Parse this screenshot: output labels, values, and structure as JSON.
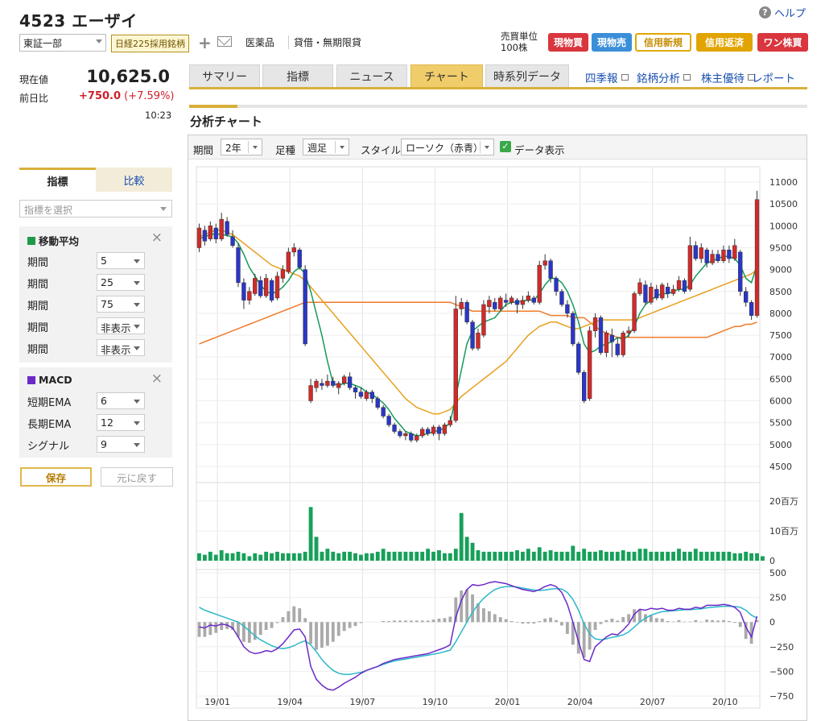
{
  "header": {
    "title": "4523 エーザイ",
    "help": "ヘルプ",
    "market": "東証一部",
    "nikkei_badge": "日経225採用銘柄",
    "sector": "医薬品",
    "lending": "貸借・無期限貸",
    "unit_label": "売買単位",
    "unit_value": "100株",
    "buttons": {
      "spot_buy": "現物買",
      "spot_sell": "現物売",
      "margin_new": "信用新規",
      "margin_close": "信用返済",
      "one_share": "ワン株買"
    }
  },
  "quote": {
    "price_label": "現在値",
    "price": "10,625.0",
    "change_label": "前日比",
    "change": "+750.0",
    "change_pct": "(+7.59%)",
    "time": "10:23"
  },
  "tabs": [
    "サマリー",
    "指標",
    "ニュース",
    "チャート",
    "時系列データ"
  ],
  "active_tab": "チャート",
  "links": [
    "四季報",
    "銘柄分析",
    "株主優待",
    "レポート"
  ],
  "section_title": "分析チャート",
  "toolbar": {
    "period_label": "期間",
    "period_value": "2年",
    "bar_label": "足種",
    "bar_value": "週足",
    "style_label": "スタイル",
    "style_value": "ローソク（赤青）",
    "data_display": "データ表示",
    "check": "✓"
  },
  "sidebar": {
    "tab_indicator": "指標",
    "tab_compare": "比較",
    "select_placeholder": "指標を選択",
    "ma_title": "移動平均",
    "ma_rows": [
      {
        "label": "期間",
        "value": "5"
      },
      {
        "label": "期間",
        "value": "25"
      },
      {
        "label": "期間",
        "value": "75"
      },
      {
        "label": "期間",
        "value": "非表示"
      },
      {
        "label": "期間",
        "value": "非表示"
      }
    ],
    "macd_title": "MACD",
    "macd_rows": [
      {
        "label": "短期EMA",
        "value": "6"
      },
      {
        "label": "長期EMA",
        "value": "12"
      },
      {
        "label": "シグナル",
        "value": "9"
      }
    ],
    "save": "保存",
    "reset": "元に戻す",
    "close": "×"
  },
  "colors": {
    "up": "#d22a2a",
    "down": "#2a36c8",
    "ma5": "#159a5a",
    "ma25": "#e8a020",
    "ma75": "#f07a2a",
    "volume": "#17a05a",
    "macd": "#6a2ac8",
    "signal": "#2bb8c8",
    "hist": "#aaaaaa",
    "ma_square": "#1e9a4a",
    "macd_square": "#6a2ac8"
  },
  "chart_data": {
    "type": "candlestick",
    "price_axis": {
      "ticks": [
        "11000",
        "10500",
        "10000",
        "9500",
        "9000",
        "8500",
        "8000",
        "7500",
        "7000",
        "6500",
        "6000",
        "5500",
        "5000",
        "4500"
      ],
      "ylim": [
        4500,
        11000
      ]
    },
    "volume_axis": {
      "ticks": [
        "20百万",
        "10百万",
        "0"
      ]
    },
    "macd_axis": {
      "ticks": [
        "500",
        "250",
        "0",
        "−250",
        "−500",
        "−750"
      ],
      "ylim": [
        -750,
        500
      ]
    },
    "x_ticks": [
      "19/01",
      "19/04",
      "19/07",
      "19/10",
      "20/01",
      "20/04",
      "20/07",
      "20/10"
    ],
    "candles": [
      [
        9500,
        9950,
        9400,
        10050
      ],
      [
        9900,
        9650,
        9550,
        10000
      ],
      [
        9700,
        10000,
        9650,
        10100
      ],
      [
        9950,
        9700,
        9600,
        10050
      ],
      [
        9700,
        10150,
        9650,
        10300
      ],
      [
        10100,
        9800,
        9750,
        10200
      ],
      [
        9750,
        9550,
        9500,
        9900
      ],
      [
        9500,
        8700,
        8600,
        9600
      ],
      [
        8700,
        8300,
        8100,
        8800
      ],
      [
        8300,
        8500,
        8200,
        8600
      ],
      [
        8450,
        8800,
        8400,
        8900
      ],
      [
        8750,
        8400,
        8350,
        8850
      ],
      [
        8400,
        8800,
        8350,
        8900
      ],
      [
        8750,
        8300,
        8250,
        8800
      ],
      [
        8350,
        8850,
        8300,
        8950
      ],
      [
        8800,
        9000,
        8700,
        9100
      ],
      [
        8950,
        9400,
        8900,
        9500
      ],
      [
        9400,
        9500,
        9300,
        9600
      ],
      [
        9450,
        9050,
        9000,
        9500
      ],
      [
        9000,
        7300,
        7250,
        9100
      ],
      [
        6000,
        6350,
        5950,
        6500
      ],
      [
        6300,
        6450,
        6200,
        6500
      ],
      [
        6400,
        6350,
        6250,
        6500
      ],
      [
        6350,
        6450,
        6300,
        6600
      ],
      [
        6450,
        6350,
        6300,
        6550
      ],
      [
        6300,
        6400,
        6150,
        6450
      ],
      [
        6400,
        6550,
        6350,
        6600
      ],
      [
        6550,
        6300,
        6250,
        6650
      ],
      [
        6300,
        6200,
        6050,
        6350
      ],
      [
        6200,
        6100,
        6050,
        6300
      ],
      [
        6050,
        6200,
        6000,
        6250
      ],
      [
        6200,
        6050,
        5950,
        6250
      ],
      [
        6050,
        5850,
        5800,
        6100
      ],
      [
        5850,
        5650,
        5600,
        5900
      ],
      [
        5650,
        5450,
        5400,
        5700
      ],
      [
        5450,
        5300,
        5250,
        5500
      ],
      [
        5300,
        5200,
        5150,
        5350
      ],
      [
        5200,
        5250,
        5100,
        5300
      ],
      [
        5250,
        5100,
        5050,
        5300
      ],
      [
        5100,
        5200,
        5050,
        5250
      ],
      [
        5200,
        5350,
        5150,
        5400
      ],
      [
        5350,
        5250,
        5200,
        5400
      ],
      [
        5250,
        5400,
        5200,
        5450
      ],
      [
        5400,
        5250,
        5100,
        5450
      ],
      [
        5250,
        5450,
        5200,
        5500
      ],
      [
        5450,
        5550,
        5400,
        5650
      ],
      [
        5550,
        8100,
        5500,
        8400
      ],
      [
        8100,
        8250,
        7950,
        8350
      ],
      [
        8250,
        7800,
        7750,
        8300
      ],
      [
        7800,
        7200,
        7150,
        7850
      ],
      [
        7200,
        7550,
        7150,
        7650
      ],
      [
        7500,
        8200,
        7450,
        8300
      ],
      [
        8150,
        8300,
        8000,
        8400
      ],
      [
        8250,
        8100,
        8050,
        8350
      ],
      [
        8100,
        8350,
        8050,
        8400
      ],
      [
        8300,
        8250,
        8150,
        8450
      ],
      [
        8250,
        8350,
        8200,
        8400
      ],
      [
        8300,
        8200,
        8000,
        8350
      ],
      [
        8200,
        8300,
        8100,
        8400
      ],
      [
        8300,
        8400,
        8250,
        8500
      ],
      [
        8350,
        8250,
        8200,
        8400
      ],
      [
        8250,
        9100,
        8200,
        9200
      ],
      [
        9100,
        9200,
        9000,
        9350
      ],
      [
        9200,
        8800,
        8700,
        9250
      ],
      [
        8800,
        8500,
        8400,
        8850
      ],
      [
        8500,
        8200,
        8150,
        8550
      ],
      [
        8200,
        8000,
        7900,
        8300
      ],
      [
        8000,
        7300,
        7250,
        8050
      ],
      [
        7300,
        6650,
        6600,
        7350
      ],
      [
        6650,
        6000,
        5950,
        6700
      ],
      [
        6050,
        7600,
        6000,
        7700
      ],
      [
        7600,
        7900,
        7450,
        8000
      ],
      [
        7900,
        7100,
        7050,
        7950
      ],
      [
        7100,
        7550,
        7000,
        7600
      ],
      [
        7500,
        7350,
        7000,
        7650
      ],
      [
        7300,
        7050,
        7000,
        7450
      ],
      [
        7050,
        7550,
        7000,
        7600
      ],
      [
        7550,
        7600,
        7450,
        7700
      ],
      [
        7600,
        8450,
        7550,
        8500
      ],
      [
        8450,
        8700,
        8400,
        8800
      ],
      [
        8650,
        8250,
        8200,
        8750
      ],
      [
        8250,
        8600,
        8200,
        8700
      ],
      [
        8550,
        8350,
        8300,
        8650
      ],
      [
        8350,
        8650,
        8300,
        8700
      ],
      [
        8600,
        8450,
        8350,
        8700
      ],
      [
        8450,
        8550,
        8400,
        8650
      ],
      [
        8550,
        8750,
        8500,
        8850
      ],
      [
        8750,
        8500,
        8450,
        8800
      ],
      [
        8550,
        9550,
        8500,
        9750
      ],
      [
        9550,
        9250,
        9200,
        9650
      ],
      [
        9250,
        9500,
        9150,
        9600
      ],
      [
        9450,
        9150,
        9050,
        9500
      ],
      [
        9150,
        9350,
        9100,
        9450
      ],
      [
        9350,
        9200,
        9150,
        9450
      ],
      [
        9200,
        9450,
        9150,
        9550
      ],
      [
        9450,
        9250,
        9150,
        9550
      ],
      [
        9250,
        9550,
        9200,
        9700
      ],
      [
        9400,
        8500,
        8400,
        9450
      ],
      [
        8500,
        8250,
        8150,
        8600
      ],
      [
        8250,
        7950,
        7850,
        8300
      ],
      [
        7950,
        10600,
        7900,
        10800
      ]
    ],
    "ma5": [
      9700,
      9750,
      9800,
      9820,
      9800,
      9780,
      9750,
      9600,
      9350,
      9050,
      8850,
      8650,
      8500,
      8450,
      8500,
      8600,
      8750,
      8950,
      9050,
      8900,
      8500,
      8000,
      7500,
      6900,
      6400,
      6350,
      6400,
      6400,
      6350,
      6300,
      6200,
      6150,
      6050,
      5950,
      5800,
      5600,
      5450,
      5300,
      5250,
      5200,
      5220,
      5250,
      5300,
      5320,
      5380,
      5500,
      6100,
      6700,
      7300,
      7600,
      7700,
      7800,
      7850,
      7900,
      8050,
      8200,
      8250,
      8250,
      8280,
      8300,
      8300,
      8450,
      8650,
      8800,
      8800,
      8700,
      8500,
      8200,
      7800,
      7300,
      7100,
      7150,
      7250,
      7300,
      7350,
      7450,
      7400,
      7500,
      7700,
      8000,
      8200,
      8300,
      8400,
      8450,
      8450,
      8500,
      8550,
      8550,
      8650,
      8850,
      9000,
      9150,
      9200,
      9250,
      9300,
      9300,
      9250,
      9100,
      8800,
      8700,
      9100
    ],
    "ma25": [
      9750,
      9800,
      9850,
      9900,
      9900,
      9850,
      9800,
      9700,
      9600,
      9500,
      9400,
      9300,
      9200,
      9100,
      9050,
      9000,
      8950,
      8900,
      8850,
      8750,
      8600,
      8450,
      8300,
      8150,
      8000,
      7850,
      7700,
      7550,
      7400,
      7250,
      7100,
      6950,
      6800,
      6650,
      6500,
      6350,
      6200,
      6050,
      5950,
      5850,
      5800,
      5750,
      5700,
      5700,
      5750,
      5800,
      5950,
      6100,
      6200,
      6300,
      6400,
      6500,
      6600,
      6700,
      6800,
      6900,
      7050,
      7200,
      7350,
      7500,
      7600,
      7700,
      7750,
      7800,
      7800,
      7750,
      7700,
      7650,
      7650,
      7700,
      7750,
      7800,
      7850,
      7850,
      7850,
      7850,
      7850,
      7850,
      7850,
      7900,
      7950,
      8000,
      8050,
      8100,
      8150,
      8200,
      8250,
      8300,
      8350,
      8400,
      8450,
      8500,
      8550,
      8600,
      8650,
      8700,
      8750,
      8800,
      8850,
      8900,
      9000
    ],
    "ma75": [
      7300,
      7350,
      7400,
      7450,
      7500,
      7550,
      7600,
      7650,
      7700,
      7750,
      7800,
      7850,
      7900,
      7950,
      8000,
      8050,
      8100,
      8150,
      8200,
      8250,
      8250,
      8250,
      8250,
      8250,
      8250,
      8250,
      8250,
      8250,
      8250,
      8250,
      8250,
      8250,
      8250,
      8250,
      8250,
      8250,
      8250,
      8250,
      8250,
      8250,
      8250,
      8250,
      8250,
      8250,
      8250,
      8250,
      8200,
      8150,
      8100,
      8050,
      8050,
      8050,
      8050,
      8050,
      8050,
      8050,
      8050,
      8050,
      8050,
      8050,
      8050,
      8050,
      8000,
      7950,
      7950,
      7950,
      7950,
      7900,
      7900,
      7900,
      7800,
      7700,
      7600,
      7550,
      7500,
      7450,
      7450,
      7450,
      7450,
      7450,
      7450,
      7450,
      7450,
      7450,
      7450,
      7450,
      7450,
      7450,
      7450,
      7450,
      7450,
      7450,
      7500,
      7550,
      7600,
      7650,
      7700,
      7700,
      7750,
      7750,
      7800
    ],
    "volume": [
      2.5,
      2,
      3,
      2,
      3.5,
      2.5,
      2.5,
      3,
      2.5,
      1.5,
      2.5,
      2,
      3,
      2.5,
      3,
      2.5,
      2.5,
      2.5,
      2.5,
      3,
      18,
      8,
      3,
      4,
      3,
      2.5,
      3,
      3,
      2.5,
      2,
      2.5,
      2.5,
      3,
      4,
      3,
      3,
      3,
      3,
      3,
      3,
      3,
      4,
      3,
      3.5,
      2.5,
      2.5,
      4,
      16,
      8,
      6,
      3.5,
      3,
      3,
      3,
      3,
      3,
      3,
      3.5,
      3,
      4,
      3,
      4.5,
      3,
      3.5,
      3,
      3,
      3,
      5,
      3,
      4,
      3,
      3,
      3.5,
      3,
      3,
      3,
      3.5,
      3,
      3,
      4,
      4,
      3,
      3,
      3,
      3,
      3,
      4,
      3,
      3,
      4,
      3,
      3,
      3,
      3,
      3,
      3,
      2.5,
      2.5,
      3,
      2.5,
      2.5,
      1.5
    ],
    "macd": [
      -50,
      -60,
      -30,
      -40,
      -20,
      -30,
      -60,
      -150,
      -250,
      -300,
      -320,
      -310,
      -290,
      -300,
      -270,
      -220,
      -150,
      -80,
      -70,
      -150,
      -450,
      -580,
      -640,
      -680,
      -690,
      -660,
      -620,
      -590,
      -560,
      -520,
      -490,
      -470,
      -450,
      -420,
      -400,
      -380,
      -370,
      -360,
      -350,
      -340,
      -330,
      -320,
      -300,
      -280,
      -260,
      -230,
      50,
      220,
      330,
      380,
      370,
      380,
      400,
      410,
      400,
      390,
      370,
      350,
      330,
      320,
      310,
      330,
      360,
      380,
      360,
      300,
      180,
      0,
      -200,
      -380,
      -400,
      -250,
      -200,
      -150,
      -120,
      -130,
      -80,
      -20,
      80,
      130,
      120,
      140,
      130,
      140,
      120,
      120,
      140,
      130,
      130,
      150,
      140,
      170,
      170,
      170,
      180,
      170,
      150,
      100,
      -50,
      -150,
      60
    ],
    "signal": [
      150,
      120,
      100,
      80,
      60,
      40,
      20,
      0,
      -40,
      -90,
      -140,
      -180,
      -210,
      -240,
      -260,
      -270,
      -260,
      -240,
      -210,
      -190,
      -230,
      -300,
      -380,
      -440,
      -490,
      -520,
      -530,
      -530,
      -520,
      -510,
      -490,
      -470,
      -450,
      -430,
      -410,
      -395,
      -385,
      -375,
      -365,
      -355,
      -345,
      -335,
      -325,
      -315,
      -300,
      -285,
      -200,
      -100,
      0,
      100,
      180,
      240,
      290,
      330,
      350,
      360,
      360,
      355,
      345,
      335,
      325,
      320,
      325,
      335,
      340,
      335,
      300,
      230,
      120,
      -20,
      -120,
      -170,
      -180,
      -170,
      -155,
      -145,
      -130,
      -100,
      -50,
      0,
      40,
      70,
      90,
      105,
      110,
      115,
      120,
      125,
      125,
      130,
      135,
      145,
      150,
      155,
      160,
      160,
      158,
      150,
      120,
      70,
      40
    ],
    "histogram": [
      -150,
      -150,
      -130,
      -110,
      -80,
      -70,
      -80,
      -150,
      -200,
      -210,
      -180,
      -130,
      -80,
      -60,
      -10,
      50,
      110,
      160,
      140,
      40,
      -220,
      -280,
      -260,
      -240,
      -200,
      -140,
      -90,
      -60,
      -40,
      -10,
      0,
      0,
      0,
      10,
      10,
      15,
      15,
      15,
      15,
      15,
      15,
      15,
      25,
      35,
      40,
      55,
      250,
      320,
      330,
      280,
      190,
      140,
      110,
      80,
      50,
      30,
      10,
      -5,
      -15,
      -15,
      -15,
      10,
      35,
      45,
      20,
      -35,
      -120,
      -230,
      -320,
      -360,
      -280,
      -80,
      -20,
      20,
      35,
      15,
      50,
      80,
      130,
      130,
      80,
      70,
      40,
      35,
      10,
      5,
      20,
      5,
      5,
      20,
      5,
      25,
      20,
      15,
      20,
      10,
      -8,
      -50,
      -170,
      -220,
      20
    ]
  }
}
